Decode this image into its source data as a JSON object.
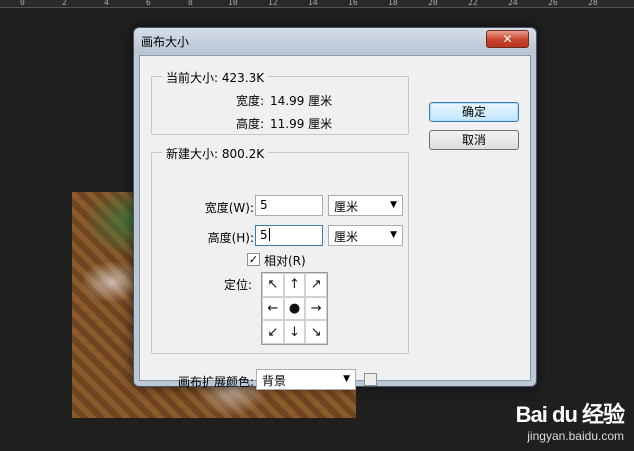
{
  "ruler": {
    "ticks": [
      "0",
      "2",
      "4",
      "6",
      "8",
      "10",
      "12",
      "14",
      "16",
      "18",
      "20",
      "22",
      "24",
      "26",
      "28"
    ]
  },
  "dialog": {
    "title": "画布大小",
    "close_label": "✕",
    "ok_label": "确定",
    "cancel_label": "取消",
    "current_size": {
      "legend": "当前大小: 423.3K",
      "width_label": "宽度:",
      "width_value": "14.99 厘米",
      "height_label": "高度:",
      "height_value": "11.99 厘米"
    },
    "new_size": {
      "legend": "新建大小: 800.2K",
      "width_label": "宽度(W):",
      "width_value": "5",
      "width_unit": "厘米",
      "height_label": "高度(H):",
      "height_value": "5",
      "height_unit": "厘米",
      "relative_label": "相对(R)",
      "relative_checked": true,
      "anchor_label": "定位:",
      "anchor_arrows": [
        "↖",
        "↑",
        "↗",
        "←",
        "●",
        "→",
        "↙",
        "↓",
        "↘"
      ]
    },
    "extension_color": {
      "label": "画布扩展颜色:",
      "value": "背景",
      "swatch_color": "#eeeeee"
    }
  },
  "watermark": {
    "logo": "Bai du 经验",
    "url": "jingyan.baidu.com"
  }
}
